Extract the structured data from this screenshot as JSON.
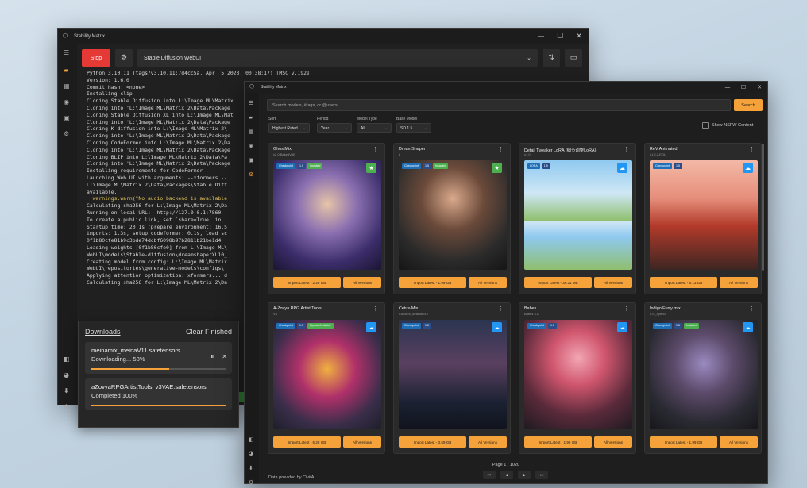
{
  "window_main": {
    "title": "Stability Matrix",
    "stop_label": "Stop",
    "package_selected": "Stable Diffusion WebUI",
    "console_lines": [
      {
        "t": "Python 3.10.11 (tags/v3.10.11:7d4cc5a, Apr  5 2023, 00:38:17) [MSC v.1929 64 bit (AMD64)]",
        "c": ""
      },
      {
        "t": "Version: 1.6.0",
        "c": ""
      },
      {
        "t": "Commit hash: <none>",
        "c": ""
      },
      {
        "t": "Installing clip",
        "c": ""
      },
      {
        "t": "Cloning Stable Diffusion into L:\\Image ML\\Matrix",
        "c": ""
      },
      {
        "t": "Cloning into 'L:\\Image ML\\Matrix 2\\Data\\Package",
        "c": ""
      },
      {
        "t": "Cloning Stable Diffusion XL into L:\\Image ML\\Mat",
        "c": ""
      },
      {
        "t": "Cloning into 'L:\\Image ML\\Matrix 2\\Data\\Package",
        "c": ""
      },
      {
        "t": "Cloning K-diffusion into L:\\Image ML\\Matrix 2\\",
        "c": ""
      },
      {
        "t": "Cloning into 'L:\\Image ML\\Matrix 2\\Data\\Package",
        "c": ""
      },
      {
        "t": "Cloning CodeFormer into L:\\Image ML\\Matrix 2\\Da",
        "c": ""
      },
      {
        "t": "Cloning into 'L:\\Image ML\\Matrix 2\\Data\\Package",
        "c": ""
      },
      {
        "t": "Cloning BLIP into L:\\Image ML\\Matrix 2\\Data\\Pa",
        "c": ""
      },
      {
        "t": "Cloning into 'L:\\Image ML\\Matrix 2\\Data\\Package",
        "c": ""
      },
      {
        "t": "Installing requirements for CodeFormer",
        "c": ""
      },
      {
        "t": "Launching Web UI with arguments: --xformers --",
        "c": ""
      },
      {
        "t": "L:\\Image ML\\Matrix 2\\Data\\Packages\\Stable Diff",
        "c": ""
      },
      {
        "t": "available.",
        "c": ""
      },
      {
        "t": "  warnings.warn(\"No audio backend is available",
        "c": "y"
      },
      {
        "t": "Calculating sha256 for L:\\Image ML\\Matrix 2\\Da",
        "c": ""
      },
      {
        "t": "Running on local URL:  http://127.0.0.1:7860",
        "c": ""
      },
      {
        "t": "",
        "c": ""
      },
      {
        "t": "To create a public link, set `share=True` in",
        "c": ""
      },
      {
        "t": "Startup time: 20.1s (prepare environment: 16.5",
        "c": ""
      },
      {
        "t": "imports: 1.3s, setup codeformer: 0.1s, load sc",
        "c": ""
      },
      {
        "t": "0f1b80cfe81b9c3bde74dcbf6098b97b2811b21be1d4",
        "c": ""
      },
      {
        "t": "Loading weights [0f1b80cfe0] from L:\\Image ML\\",
        "c": ""
      },
      {
        "t": "WebUI\\models\\Stable-diffusion\\dreamshaperXL10_",
        "c": ""
      },
      {
        "t": "Creating model from config: L:\\Image ML\\Matrix",
        "c": ""
      },
      {
        "t": "WebUI\\repositories\\generative-models\\configs\\",
        "c": ""
      },
      {
        "t": "Applying attention optimization: xformers... d",
        "c": ""
      },
      {
        "t": "Calculating sha256 for L:\\Image ML\\Matrix 2\\Da",
        "c": ""
      }
    ]
  },
  "downloads": {
    "title": "Downloads",
    "clear_label": "Clear Finished",
    "items": [
      {
        "name": "meinamix_meinaV11.safetensors",
        "status": "Downloading... 58%",
        "progress": 0.58
      },
      {
        "name": "aZovyaRPGArtistTools_v3VAE.safetensors",
        "status": "Completed 100%",
        "progress": 1.0
      }
    ]
  },
  "window_browser": {
    "title": "Stability Matrix",
    "search_placeholder": "Search models, #tags, or @users",
    "search_button": "Search",
    "filters": [
      {
        "label": "Sort",
        "value": "Highest Rated"
      },
      {
        "label": "Period",
        "value": "Year"
      },
      {
        "label": "Model Type",
        "value": "All"
      },
      {
        "label": "Base Model",
        "value": "SD 1.5"
      }
    ],
    "nsfw_label": "Show NSFW Content",
    "cards": [
      {
        "title": "GhostMix",
        "sub": "v2.0-BakedVAE",
        "tags": [
          "Checkpoint",
          "1.5",
          "Installed"
        ],
        "badge": "green",
        "import": "Import Latest - 2.28 GB"
      },
      {
        "title": "DreamShaper",
        "sub": "8",
        "tags": [
          "Checkpoint",
          "1.5",
          "Installed"
        ],
        "badge": "green",
        "import": "Import Latest - 1.99 GB"
      },
      {
        "title": "Detail Tweaker LoRA (细节调整LoRA)",
        "sub": "v1.0",
        "tags": [
          "LORA",
          "1.5"
        ],
        "badge": "blue",
        "import": "Import Latest - 36.11 MB"
      },
      {
        "title": "ReV Animated",
        "sub": "v1.2.2-EOL",
        "tags": [
          "Checkpoint",
          "1.5"
        ],
        "badge": "blue",
        "import": "Import Latest - 5.13 GB"
      },
      {
        "title": "A-Zovya RPG Artist Tools",
        "sub": "V4",
        "tags": [
          "Checkpoint",
          "1.5",
          "Update Available"
        ],
        "badge": "blue",
        "import": "Import Latest - 5.28 GB"
      },
      {
        "title": "Cetus-Mix",
        "sub": "Coda2/v_defaulted-2",
        "tags": [
          "Checkpoint",
          "1.5"
        ],
        "badge": "blue",
        "import": "Import Latest - 3.59 GB"
      },
      {
        "title": "Babes",
        "sub": "Babes 3.1",
        "tags": [
          "Checkpoint",
          "1.5"
        ],
        "badge": "blue",
        "import": "Import Latest - 1.99 GB"
      },
      {
        "title": "Indigo Furry mix",
        "sub": "v75_hybrid",
        "tags": [
          "Checkpoint",
          "1.5",
          "Installed"
        ],
        "badge": "blue",
        "import": "Import Latest - 1.99 GB"
      }
    ],
    "versions_label": "All Versions",
    "page_text": "Page 1 / 1020",
    "credit": "Data provided by CivitAI"
  },
  "icons": {
    "menu": "☰",
    "gear": "⚙",
    "close": "✕",
    "minimize": "—",
    "maximize": "☐",
    "more": "⋮",
    "star": "★",
    "cloud": "☁",
    "chevron": "⌄",
    "swap": "⇅",
    "prev": "◀",
    "next": "▶",
    "first": "⏮",
    "last": "⏭"
  }
}
